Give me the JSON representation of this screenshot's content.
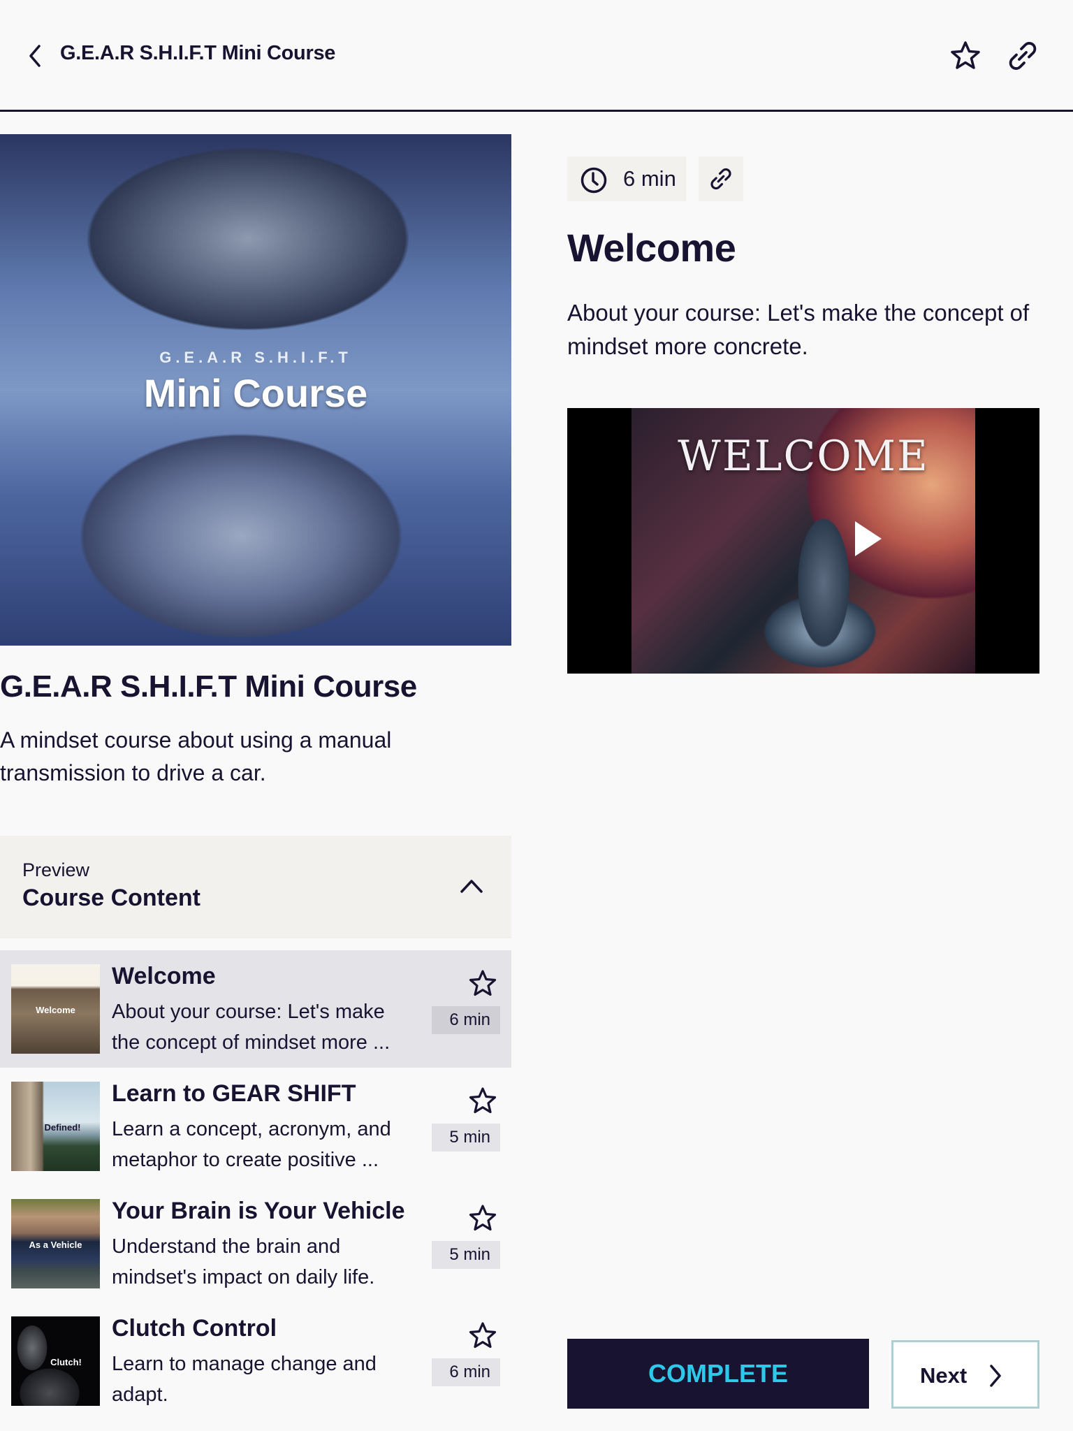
{
  "header": {
    "title": "G.E.A.R S.H.I.F.T Mini Course",
    "back_icon": "chevron-left-icon",
    "favorite_icon": "star-icon",
    "share_icon": "link-icon"
  },
  "course": {
    "cover": {
      "subtitle": "G.E.A.R S.H.I.F.T",
      "title": "Mini Course"
    },
    "title": "G.E.A.R S.H.I.F.T Mini Course",
    "description": "A mindset course about using a manual transmission to drive a car."
  },
  "content_panel": {
    "pre_label": "Preview",
    "title": "Course Content",
    "expanded": true,
    "toggle_icon": "chevron-up-icon"
  },
  "lessons": [
    {
      "title": "Welcome",
      "description": "About your course: Let's make the concept of mindset more ...",
      "duration": "6 min",
      "thumbnail_text": "Welcome",
      "active": true
    },
    {
      "title": "Learn to GEAR SHIFT",
      "description": "Learn a concept, acronym, and metaphor to create positive ...",
      "duration": "5 min",
      "thumbnail_text": "Defined!",
      "active": false
    },
    {
      "title": "Your Brain is Your Vehicle",
      "description": "Understand the brain and mindset's impact on daily life.",
      "duration": "5 min",
      "thumbnail_text": "As a Vehicle",
      "active": false
    },
    {
      "title": "Clutch Control",
      "description": "Learn to manage change and adapt.",
      "duration": "6 min",
      "thumbnail_text": "Clutch!",
      "active": false
    }
  ],
  "current_lesson": {
    "duration": "6 min",
    "title": "Welcome",
    "about": "About your course: Let's make the concept of mindset more concrete.",
    "video": {
      "overlay_text": "WELCOME",
      "play_icon": "play-icon"
    }
  },
  "actions": {
    "complete_label": "COMPLETE",
    "next_label": "Next"
  },
  "colors": {
    "primary": "#171330",
    "accent": "#2ec9ea",
    "panel_bg": "#f2f1ee",
    "active_row_bg": "#e4e3e8",
    "next_border": "#a9d0d2"
  }
}
